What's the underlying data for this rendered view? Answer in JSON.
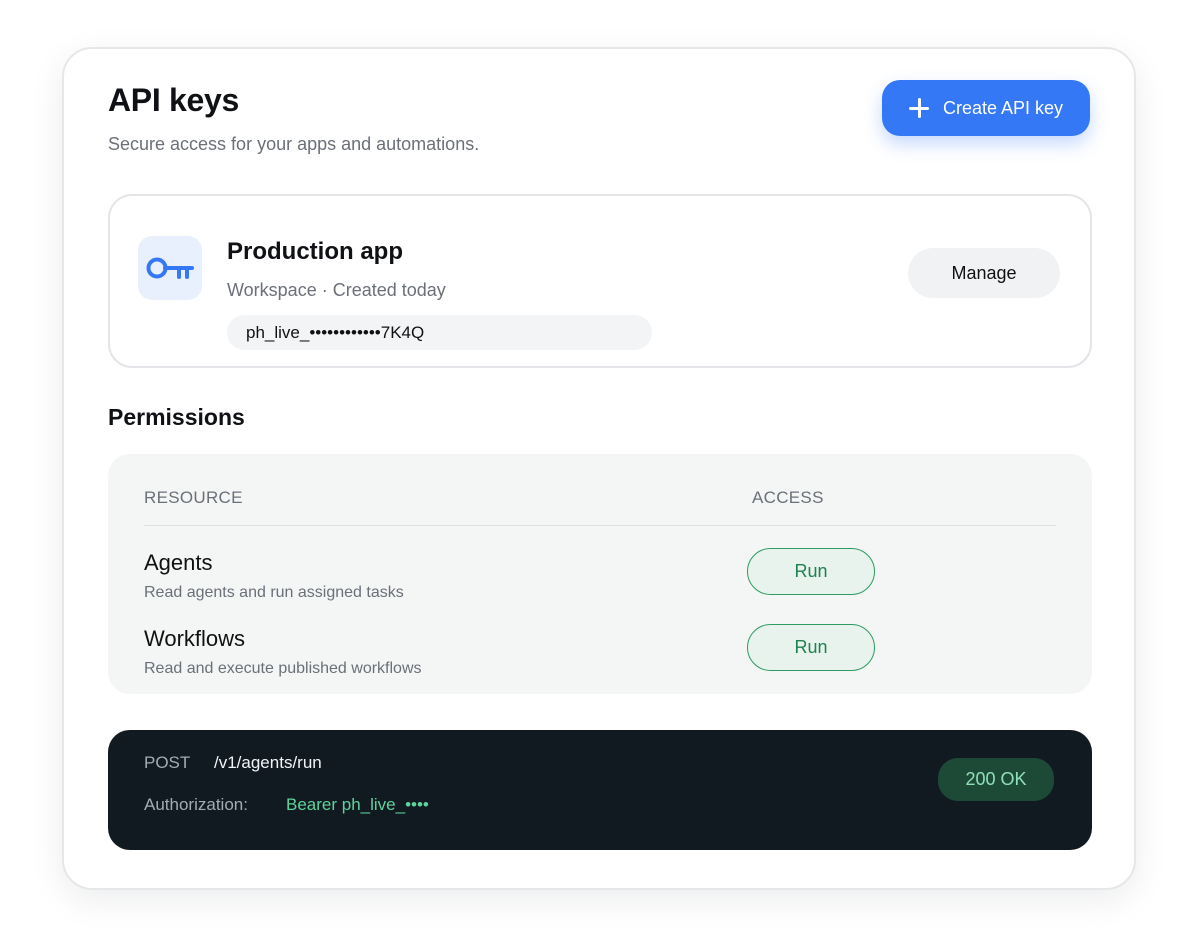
{
  "header": {
    "title": "API keys",
    "subtitle": "Secure access for your apps and automations.",
    "create_button_label": "Create API key"
  },
  "key_card": {
    "icon": "key-icon",
    "name": "Production app",
    "meta": "Workspace · Created today",
    "masked_key": "ph_live_••••••••••••7K4Q",
    "manage_label": "Manage"
  },
  "permissions": {
    "title": "Permissions",
    "columns": [
      "RESOURCE",
      "ACCESS"
    ],
    "rows": [
      {
        "name": "Agents",
        "description": "Read agents and run assigned tasks",
        "access": "Run"
      },
      {
        "name": "Workflows",
        "description": "Read and execute published workflows",
        "access": "Run"
      }
    ]
  },
  "request": {
    "method": "POST",
    "path": "/v1/agents/run",
    "auth_label": "Authorization:",
    "auth_value": "Bearer ph_live_••••",
    "status": "200 OK"
  },
  "colors": {
    "accent": "#3478f6",
    "success": "#1f8150",
    "console_bg": "#121a21"
  }
}
